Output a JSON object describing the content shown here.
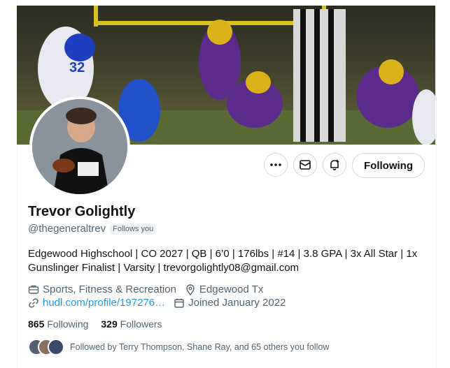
{
  "profile": {
    "name": "Trevor Golightly",
    "handle": "@thegeneraltrev",
    "follows_you": "Follows you",
    "bio": "Edgewood Highschool | CO 2027 | QB | 6’0 | 176lbs | #14 | 3.8 GPA | 3x All Star | 1x Gunslinger Finalist | Varsity | trevorgolightly08@gmail.com",
    "category": "Sports, Fitness & Recreation",
    "location": "Edgewood Tx",
    "website": "hudl.com/profile/197276…",
    "joined": "Joined January 2022"
  },
  "stats": {
    "following_count": "865",
    "following_label": "Following",
    "followers_count": "329",
    "followers_label": "Followers"
  },
  "followed_by": "Followed by Terry Thompson, Shane Ray, and 65 others you follow",
  "actions": {
    "more_icon": "more-icon",
    "message_icon": "message-icon",
    "notify_icon": "notification-bell-icon",
    "following_label": "Following"
  },
  "colors": {
    "accent": "#1d9bf0",
    "secondary_text": "#536471",
    "border": "#cfd9de"
  }
}
